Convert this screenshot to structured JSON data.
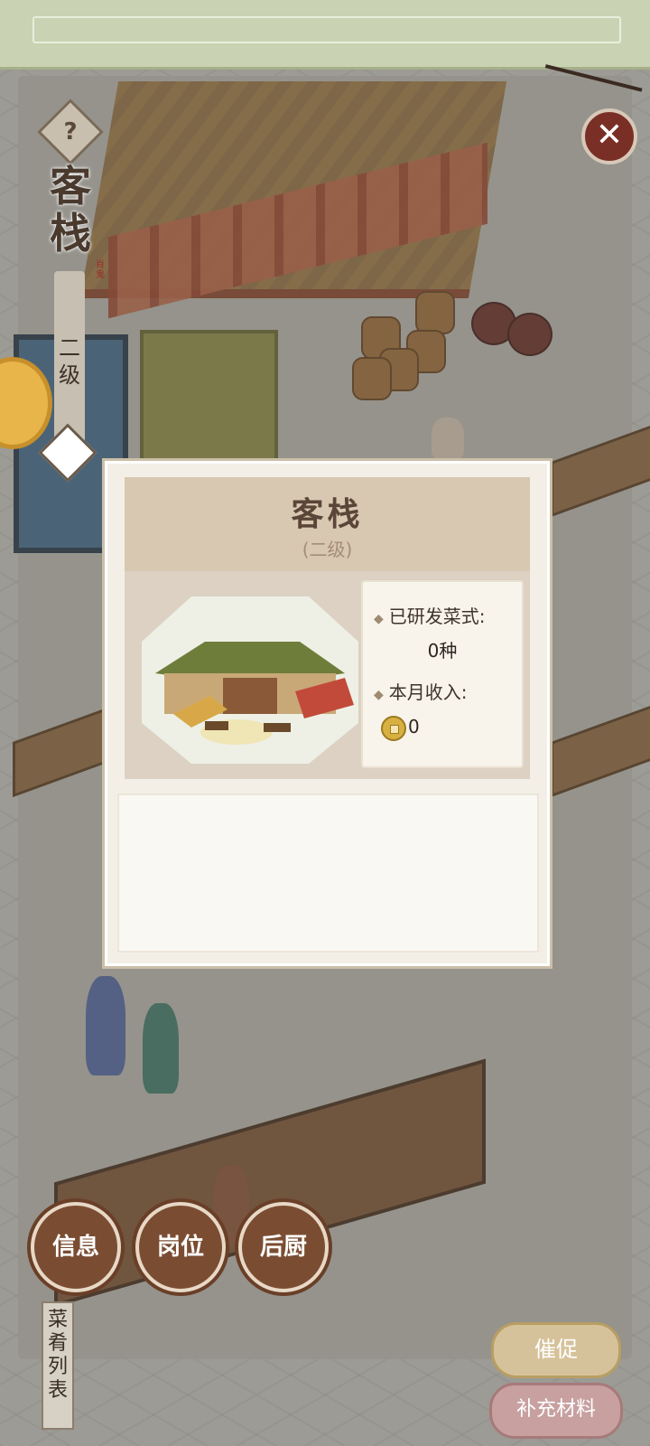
{
  "building": {
    "name": "客栈",
    "level_vertical": "二级",
    "side_tag": "肖鬼"
  },
  "icons": {
    "help": "question-mark-icon",
    "close": "close-icon",
    "coin": "copper-coin-icon",
    "level": "diamond-icon"
  },
  "modal": {
    "title": "客栈",
    "subtitle": "(二级)",
    "dishes_label": "已研发菜式:",
    "dishes_value": "0种",
    "income_label": "本月收入:",
    "income_value": "0"
  },
  "bottom_nav": {
    "info": "信息",
    "post": "岗位",
    "kitchen": "后厨"
  },
  "menu_list_tab": "菜肴列表",
  "actions": {
    "urge": "催促",
    "supply": "补充材料"
  },
  "colors": {
    "accent_brown": "#7a4d32",
    "urge": "#d6c29a",
    "supply": "#c8a0a0",
    "close": "#7a2f26"
  }
}
